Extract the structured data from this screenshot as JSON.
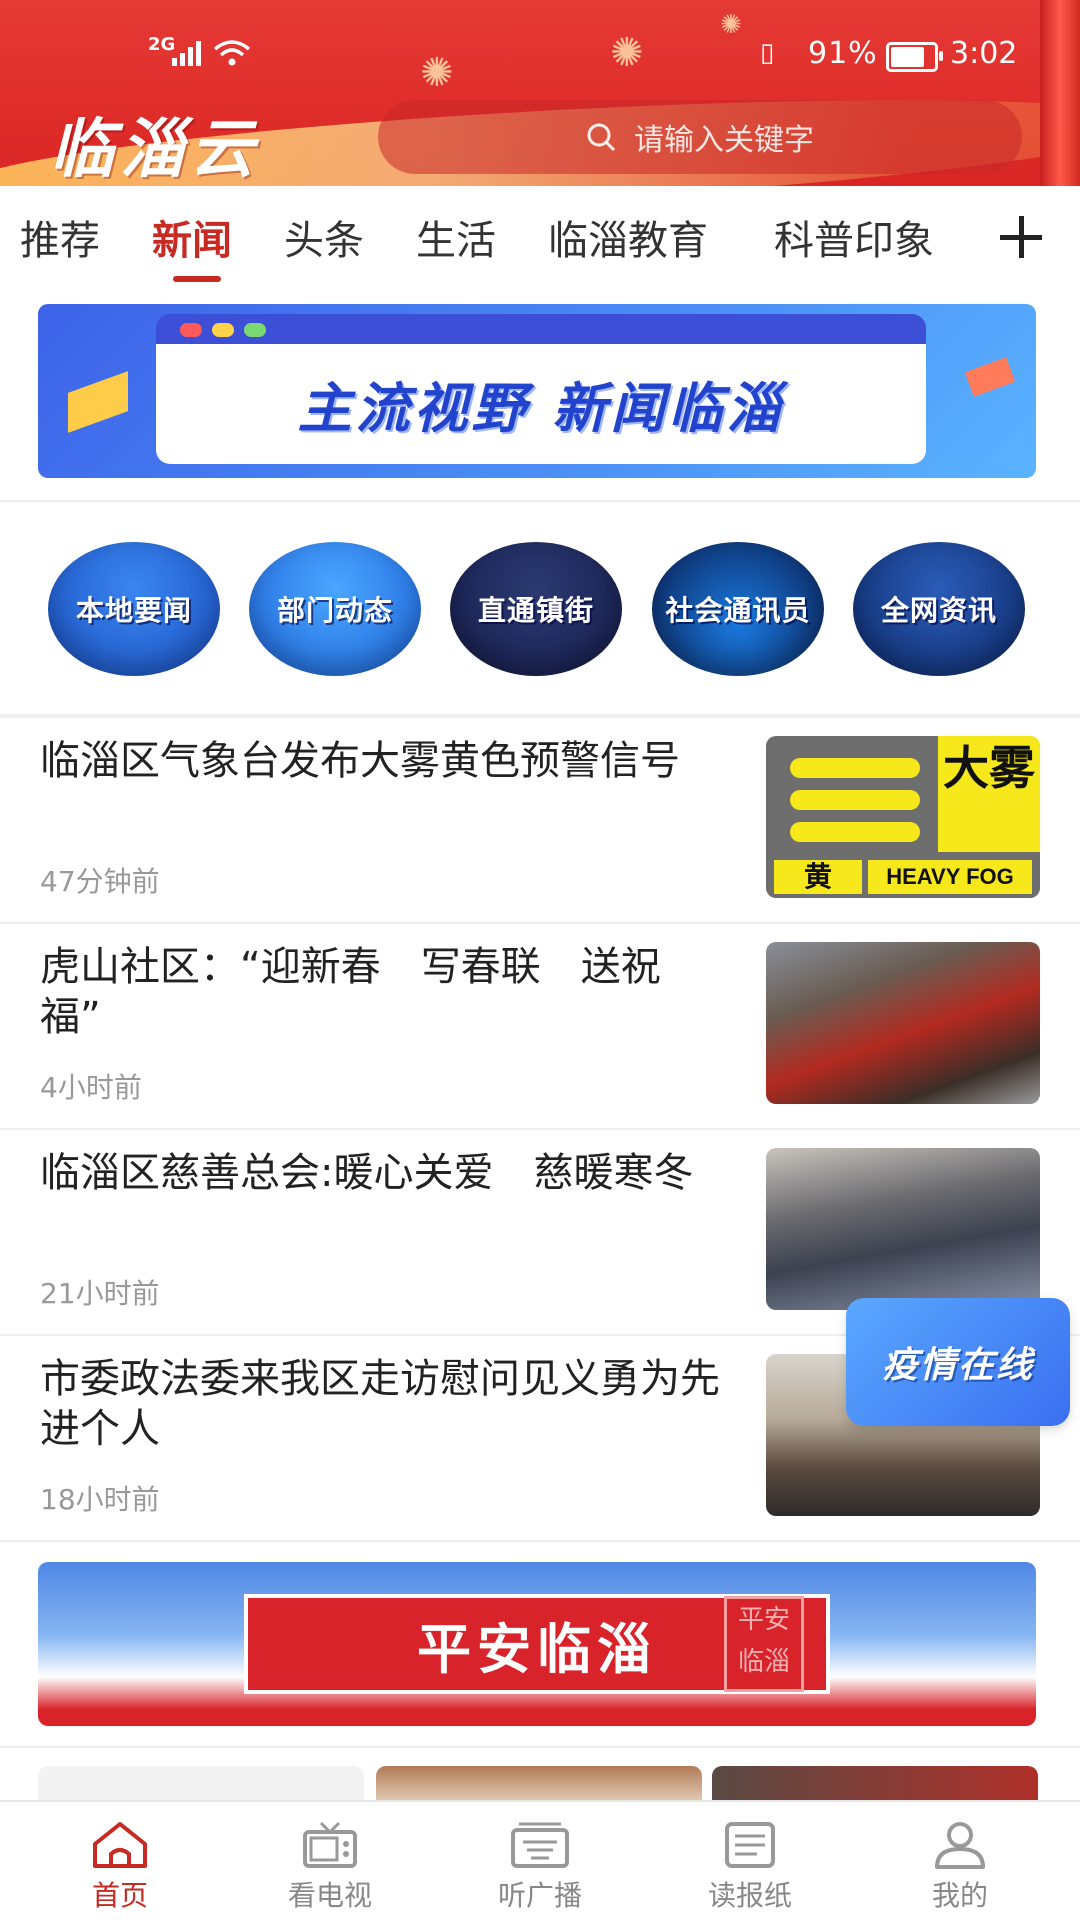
{
  "status_bar": {
    "network": "2G",
    "battery": "91%",
    "battery_level": 0.91,
    "time": "3:02"
  },
  "header": {
    "logo": "临淄云",
    "search_placeholder": "请输入关键字"
  },
  "tabs": [
    {
      "label": "推荐",
      "active": false
    },
    {
      "label": "新闻",
      "active": true
    },
    {
      "label": "头条",
      "active": false
    },
    {
      "label": "生活",
      "active": false
    },
    {
      "label": "临淄教育",
      "active": false
    },
    {
      "label": "科普印象",
      "active": false
    }
  ],
  "banner_top": {
    "slogan": "主流视野 新闻临淄"
  },
  "categories": [
    {
      "label": "本地要闻"
    },
    {
      "label": "部门动态"
    },
    {
      "label": "直通镇街"
    },
    {
      "label": "社会通讯员"
    },
    {
      "label": "全网资讯"
    }
  ],
  "news": [
    {
      "title": "临淄区气象台发布大雾黄色预警信号",
      "time": "47分钟前",
      "thumb": {
        "big": "大雾",
        "level": "黄",
        "caption": "HEAVY FOG"
      }
    },
    {
      "title": "虎山社区：“迎新春　写春联　送祝福”",
      "time": "4小时前"
    },
    {
      "title": "临淄区慈善总会:暖心关爱　慈暖寒冬",
      "time": "21小时前"
    },
    {
      "title": "市委政法委来我区走访慰问见义勇为先进个人",
      "time": "18小时前"
    }
  ],
  "floating_badge": "疫情在线",
  "banner_safe": {
    "text": "平安临淄",
    "seal": "平安临淄"
  },
  "bottom_nav": [
    {
      "label": "首页",
      "icon": "home-icon",
      "active": true
    },
    {
      "label": "看电视",
      "icon": "tv-icon",
      "active": false
    },
    {
      "label": "听广播",
      "icon": "radio-icon",
      "active": false
    },
    {
      "label": "读报纸",
      "icon": "newspaper-icon",
      "active": false
    },
    {
      "label": "我的",
      "icon": "user-icon",
      "active": false
    }
  ],
  "colors": {
    "brand_red": "#c62a22",
    "header_red": "#e53a35",
    "muted_text": "#999999"
  }
}
